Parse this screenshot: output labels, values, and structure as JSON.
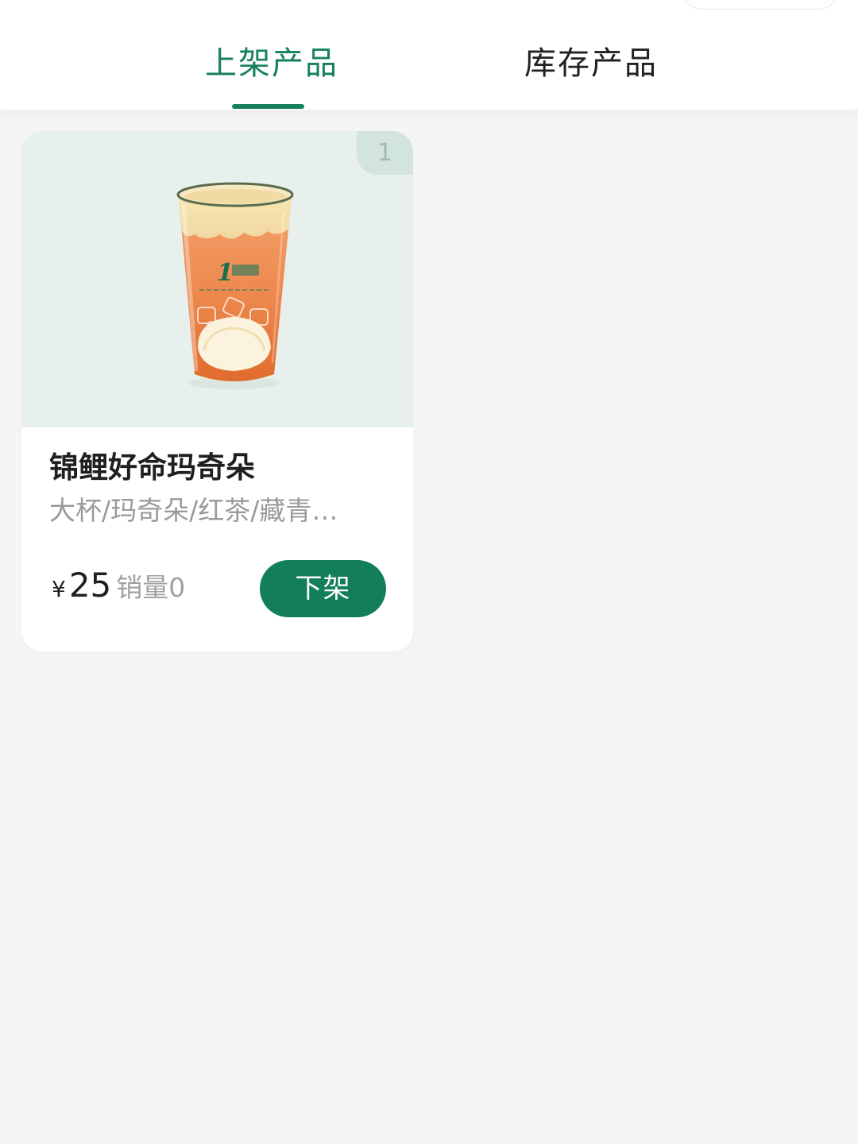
{
  "tabs": {
    "listed_label": "上架产品",
    "inventory_label": "库存产品",
    "active": "listed"
  },
  "products": [
    {
      "index": "1",
      "name": "锦鲤好命玛奇朵",
      "description": "大杯/玛奇朵/红茶/藏青…",
      "currency": "¥",
      "price": "25",
      "sales": "销量0",
      "action_label": "下架"
    }
  ],
  "colors": {
    "accent": "#16805d",
    "button": "#137f5a",
    "page_bg": "#f5f5f5",
    "image_bg": "#e7f0ec"
  }
}
